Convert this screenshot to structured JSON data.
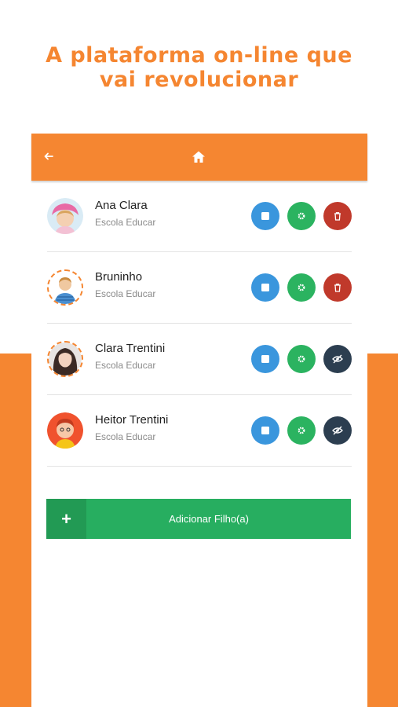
{
  "headline": {
    "line1": "A plataforma on-line que",
    "line2": "vai revolucionar"
  },
  "topbar": {
    "back_icon": "arrow-left-icon",
    "home_icon": "home-icon"
  },
  "children": [
    {
      "name": "Ana Clara",
      "school": "Escola Educar",
      "third_action": "delete"
    },
    {
      "name": "Bruninho",
      "school": "Escola Educar",
      "third_action": "delete"
    },
    {
      "name": "Clara Trentini",
      "school": "Escola Educar",
      "third_action": "hide"
    },
    {
      "name": "Heitor Trentini",
      "school": "Escola Educar",
      "third_action": "hide"
    }
  ],
  "add_child": {
    "plus": "+",
    "label": "Adicionar Filho(a)"
  },
  "colors": {
    "brand_orange": "#f58631",
    "blue": "#3a96dd",
    "green": "#2bb360",
    "red": "#c0392b",
    "navy": "#2c3e50",
    "add_green": "#27ae60"
  }
}
